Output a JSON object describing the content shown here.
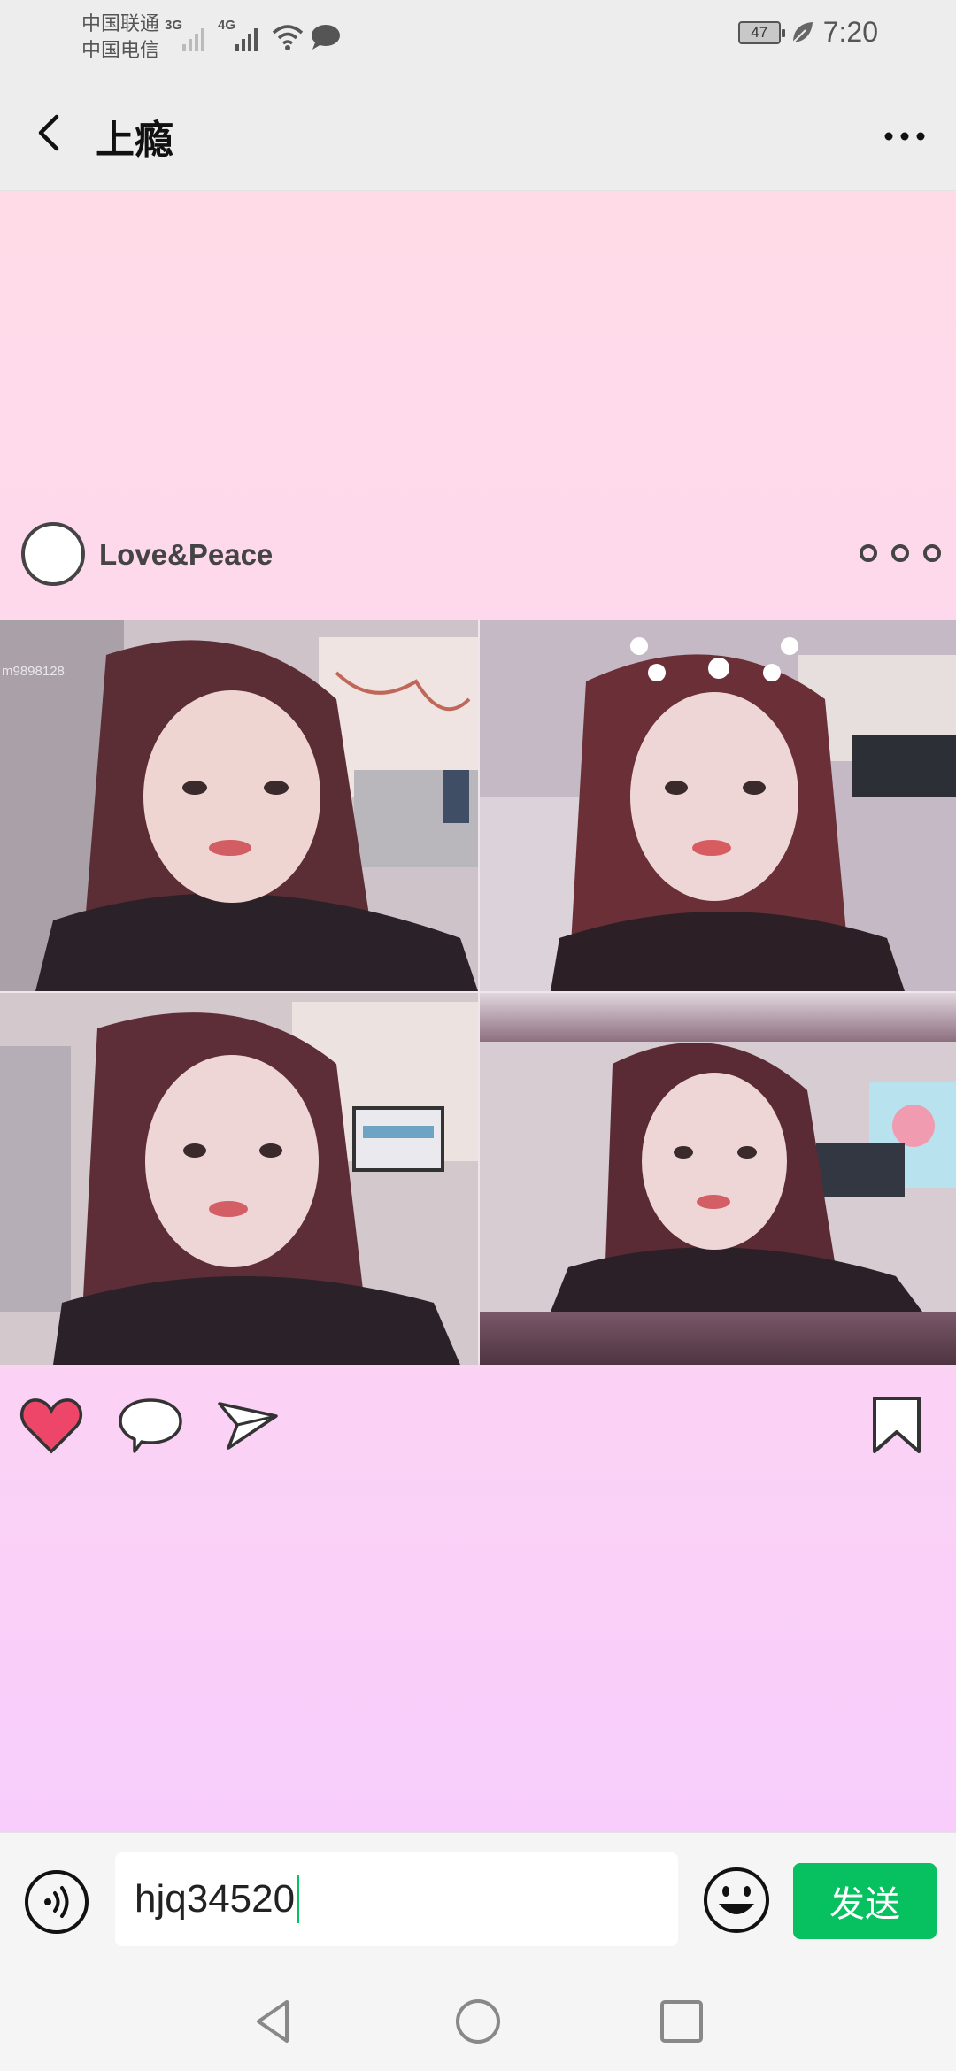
{
  "status_bar": {
    "carrier_1": "中国联通",
    "carrier_2": "中国电信",
    "net_1": "3G",
    "net_2": "4G",
    "battery": "47",
    "time": "7:20"
  },
  "header": {
    "title": "上瘾"
  },
  "post": {
    "username": "Love&Peace",
    "watermark": "m9898128",
    "photo_count": 4
  },
  "composer": {
    "input_value": "hjq34520",
    "send_label": "发送"
  },
  "colors": {
    "accent": "#07c160",
    "heart": "#ee4668",
    "bg_top": "#ffdbe8",
    "bg_bottom": "#f8cdfc"
  }
}
